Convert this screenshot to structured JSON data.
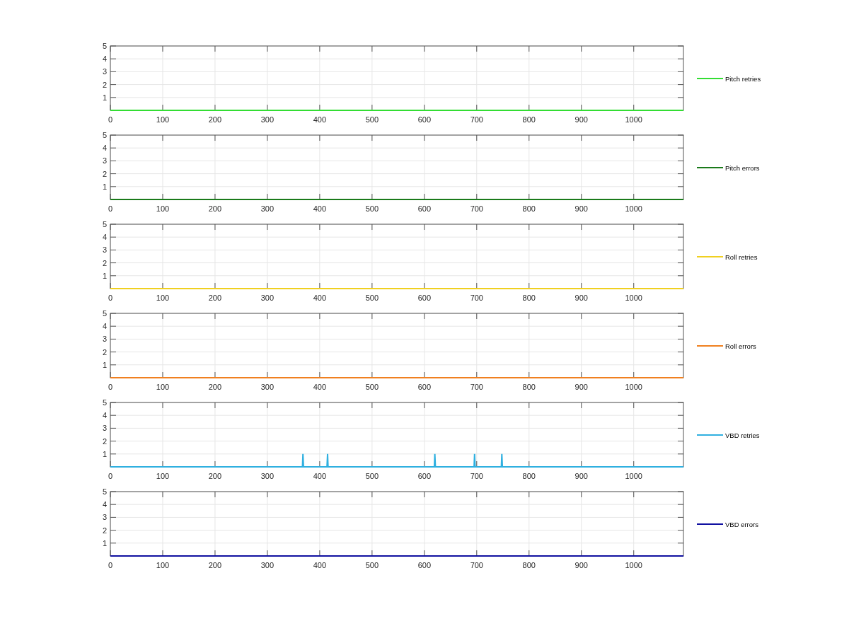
{
  "panels": [
    {
      "chart_data": {
        "type": "line",
        "grid": true,
        "xlim": [
          0,
          1095
        ],
        "ylim": [
          0,
          5
        ],
        "xticks": [
          0,
          100,
          200,
          300,
          400,
          500,
          600,
          700,
          800,
          900,
          1000
        ],
        "yticks": [
          1,
          2,
          3,
          4,
          5
        ],
        "x": [
          0,
          1095
        ],
        "series": [
          {
            "name": "Pitch retries",
            "color": "#33dd33",
            "values": [
              0,
              0
            ]
          }
        ]
      }
    },
    {
      "chart_data": {
        "type": "line",
        "grid": true,
        "xlim": [
          0,
          1095
        ],
        "ylim": [
          0,
          5
        ],
        "xticks": [
          0,
          100,
          200,
          300,
          400,
          500,
          600,
          700,
          800,
          900,
          1000
        ],
        "yticks": [
          1,
          2,
          3,
          4,
          5
        ],
        "x": [
          0,
          1095
        ],
        "series": [
          {
            "name": "Pitch errors",
            "color": "#1a7a1a",
            "values": [
              0,
              0
            ]
          }
        ]
      }
    },
    {
      "chart_data": {
        "type": "line",
        "grid": true,
        "xlim": [
          0,
          1095
        ],
        "ylim": [
          0,
          5
        ],
        "xticks": [
          0,
          100,
          200,
          300,
          400,
          500,
          600,
          700,
          800,
          900,
          1000
        ],
        "yticks": [
          1,
          2,
          3,
          4,
          5
        ],
        "x": [
          0,
          1095
        ],
        "series": [
          {
            "name": "Roll retries",
            "color": "#f0d020",
            "values": [
              0,
              0
            ]
          }
        ]
      }
    },
    {
      "chart_data": {
        "type": "line",
        "grid": true,
        "xlim": [
          0,
          1095
        ],
        "ylim": [
          0,
          5
        ],
        "xticks": [
          0,
          100,
          200,
          300,
          400,
          500,
          600,
          700,
          800,
          900,
          1000
        ],
        "yticks": [
          1,
          2,
          3,
          4,
          5
        ],
        "x": [
          0,
          1095
        ],
        "series": [
          {
            "name": "Roll errors",
            "color": "#f08020",
            "values": [
              0,
              0
            ]
          }
        ]
      }
    },
    {
      "chart_data": {
        "type": "line",
        "grid": true,
        "xlim": [
          0,
          1095
        ],
        "ylim": [
          0,
          5
        ],
        "xticks": [
          0,
          100,
          200,
          300,
          400,
          500,
          600,
          700,
          800,
          900,
          1000
        ],
        "yticks": [
          1,
          2,
          3,
          4,
          5
        ],
        "x": [
          0,
          367,
          368,
          369,
          414,
          415,
          416,
          619,
          620,
          621,
          695,
          696,
          697,
          747,
          748,
          749,
          1095
        ],
        "series": [
          {
            "name": "VBD retries",
            "color": "#30b0e0",
            "values": [
              0,
              0,
              1,
              0,
              0,
              1,
              0,
              0,
              1,
              0,
              0,
              1,
              0,
              0,
              1,
              0,
              0
            ]
          }
        ]
      }
    },
    {
      "chart_data": {
        "type": "line",
        "grid": true,
        "xlim": [
          0,
          1095
        ],
        "ylim": [
          0,
          5
        ],
        "xticks": [
          0,
          100,
          200,
          300,
          400,
          500,
          600,
          700,
          800,
          900,
          1000
        ],
        "yticks": [
          1,
          2,
          3,
          4,
          5
        ],
        "x": [
          0,
          1095
        ],
        "series": [
          {
            "name": "VBD errors",
            "color": "#1010a0",
            "values": [
              0,
              0
            ]
          }
        ]
      }
    }
  ]
}
